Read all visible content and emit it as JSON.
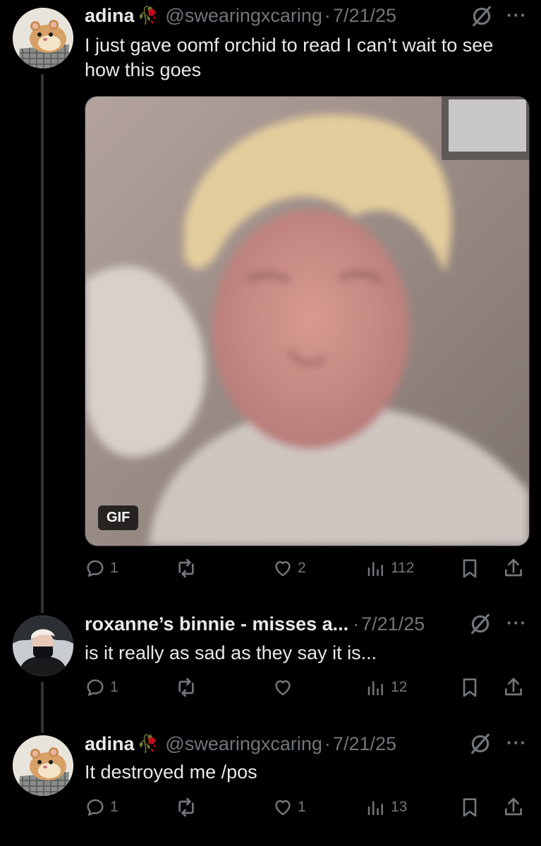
{
  "posts": [
    {
      "author_name": "adina",
      "name_emoji": "🥀",
      "handle": "@swearingxcaring",
      "separator": "·",
      "date": "7/21/25",
      "more_label": "···",
      "text": "I just gave oomf orchid to read I can’t wait to see how this goes",
      "media": {
        "badge": "GIF",
        "bg": "#9a8a84"
      },
      "stats": {
        "replies": "1",
        "reposts": "",
        "likes": "2",
        "views": "112"
      }
    },
    {
      "author_name": "roxanne’s binnie - misses a...",
      "handle": "",
      "separator": "·",
      "date": "7/21/25",
      "more_label": "···",
      "text": "is it really as sad as they say it is...",
      "stats": {
        "replies": "1",
        "reposts": "",
        "likes": "",
        "views": "12"
      }
    },
    {
      "author_name": "adina",
      "name_emoji": "🥀",
      "handle": "@swearingxcaring",
      "separator": "·",
      "date": "7/21/25",
      "more_label": "···",
      "text": "It destroyed me /pos",
      "stats": {
        "replies": "1",
        "reposts": "",
        "likes": "1",
        "views": "13"
      }
    }
  ],
  "colors": {
    "background": "#000000",
    "text": "#e7e9ea",
    "secondary": "#71767b",
    "thread_line": "#2f3336"
  }
}
